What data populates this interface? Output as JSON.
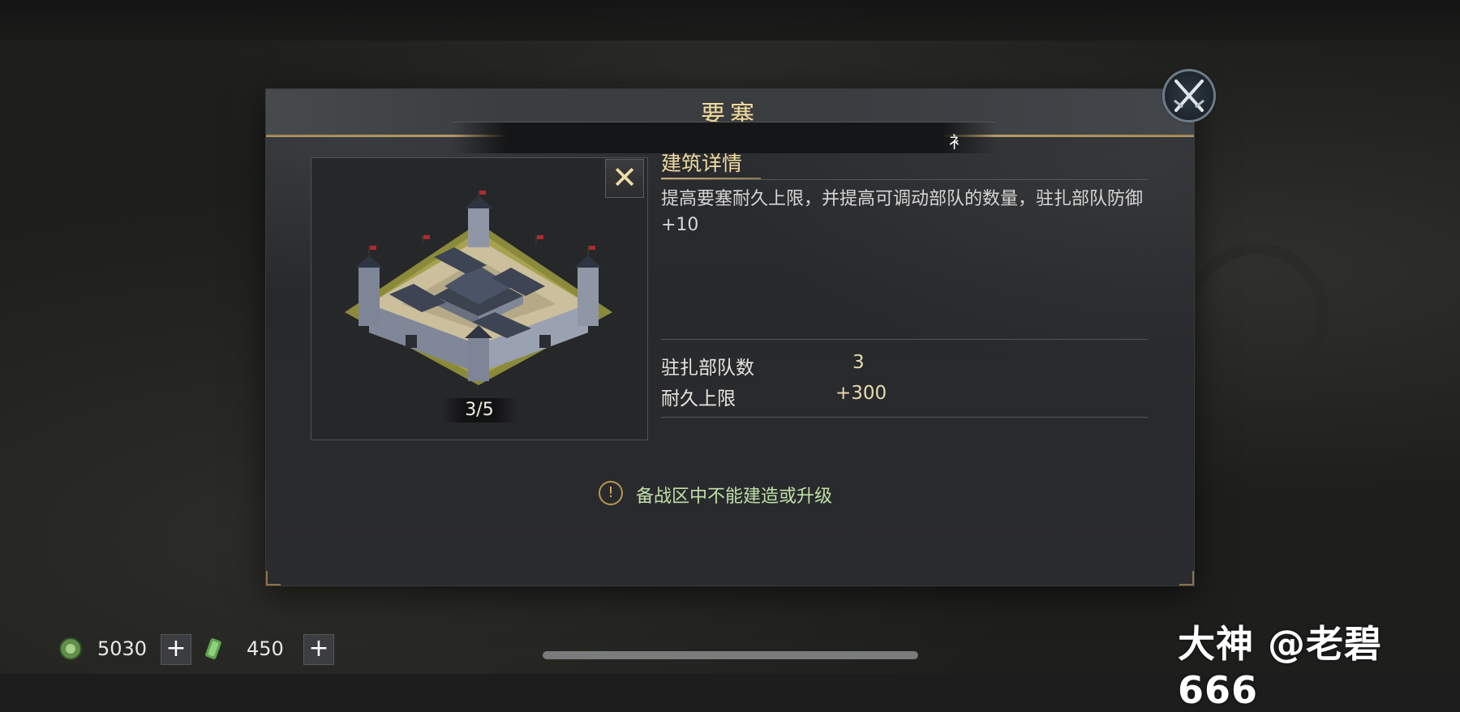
{
  "dialog": {
    "title": "要塞",
    "tab_glyph": "衤",
    "level": "3/5",
    "details_title": "建筑详情",
    "description": "提高要塞耐久上限，并提高可调动部队的数量，驻扎部队防御+10",
    "stats": [
      {
        "label": "驻扎部队数",
        "value": "3"
      },
      {
        "label": "耐久上限",
        "value": "+300"
      }
    ],
    "warning_icon": "!",
    "warning": "备战区中不能建造或升级",
    "close_x": "✕"
  },
  "resources": [
    {
      "icon": "jade-coin-icon",
      "value": "5030",
      "plus": "+"
    },
    {
      "icon": "green-scroll-icon",
      "value": "450",
      "plus": "+"
    }
  ],
  "watermark": "大神 @老碧666",
  "colors": {
    "gold_text": "#f1dca1",
    "warning_green": "#bfe0a6",
    "panel_bg": "#2a2b2e"
  }
}
